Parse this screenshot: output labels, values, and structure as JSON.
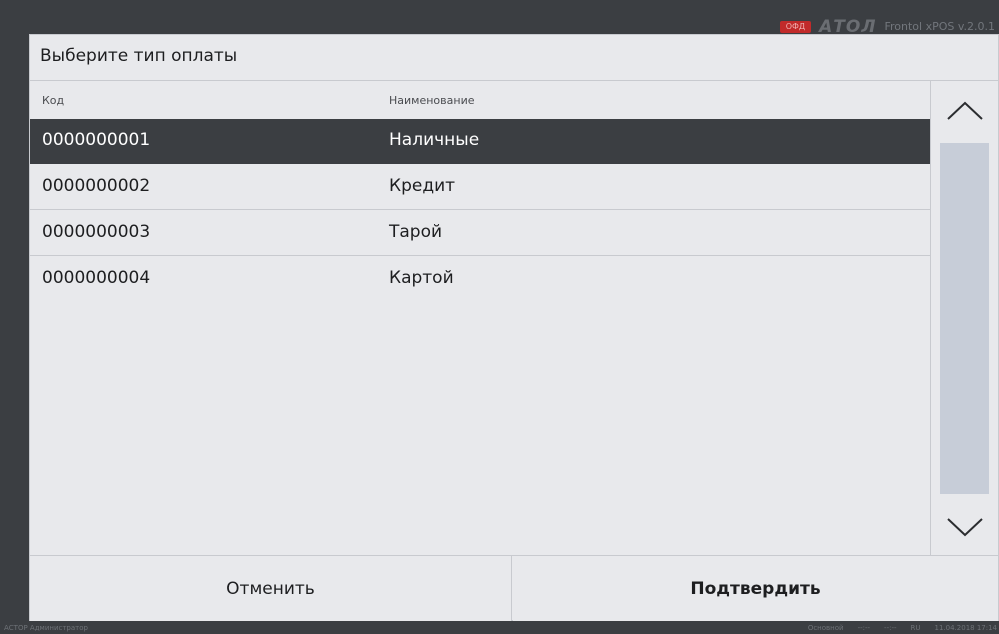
{
  "brand": {
    "badge": "ОФД",
    "logo": "АТОЛ",
    "version": "Frontol xPOS v.2.0.1"
  },
  "dialog": {
    "title": "Выберите тип оплаты",
    "columns": {
      "code": "Код",
      "name": "Наименование"
    },
    "rows": [
      {
        "code": "0000000001",
        "name": "Наличные",
        "selected": true
      },
      {
        "code": "0000000002",
        "name": "Кредит",
        "selected": false
      },
      {
        "code": "0000000003",
        "name": "Тарой",
        "selected": false
      },
      {
        "code": "0000000004",
        "name": "Картой",
        "selected": false
      }
    ],
    "cancel_label": "Отменить",
    "confirm_label": "Подтвердить"
  },
  "statusbar": {
    "left": "АСТОР Администратор",
    "mode": "Основной",
    "field1": "--:--",
    "field2": "--:--",
    "lang": "RU",
    "datetime": "11.04.2018 17:14"
  },
  "colors": {
    "background": "#3b3e42",
    "dialog": "#e8e9ec",
    "selected_row": "#3b3e42",
    "scroll_thumb": "#c7cdd8",
    "badge": "#c12a2a"
  },
  "icons": {
    "scroll_up": "chevron-up-icon",
    "scroll_down": "chevron-down-icon"
  }
}
